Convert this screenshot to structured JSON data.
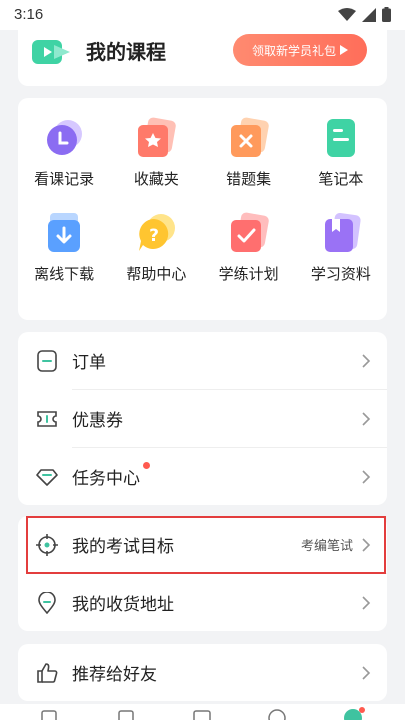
{
  "statusbar": {
    "time": "3:16"
  },
  "course": {
    "title": "我的课程",
    "promo": "领取新学员礼包"
  },
  "grid": {
    "items": [
      {
        "label": "看课记录",
        "icon": "history-icon",
        "color": "#8b6cf2"
      },
      {
        "label": "收藏夹",
        "icon": "star-folder-icon",
        "color": "#ff7a6a"
      },
      {
        "label": "错题集",
        "icon": "wrong-answers-icon",
        "color": "#ff9a5c"
      },
      {
        "label": "笔记本",
        "icon": "notebook-icon",
        "color": "#3fd3a4"
      },
      {
        "label": "离线下载",
        "icon": "download-icon",
        "color": "#5aa0ff"
      },
      {
        "label": "帮助中心",
        "icon": "help-icon",
        "color": "#ffc530"
      },
      {
        "label": "学练计划",
        "icon": "plan-check-icon",
        "color": "#ff6f6f"
      },
      {
        "label": "学习资料",
        "icon": "bookmark-icon",
        "color": "#9a72f5"
      }
    ]
  },
  "list1": [
    {
      "label": "订单",
      "icon": "order-icon"
    },
    {
      "label": "优惠券",
      "icon": "coupon-icon"
    },
    {
      "label": "任务中心",
      "icon": "task-diamond-icon",
      "dot": true
    }
  ],
  "list2": [
    {
      "label": "我的考试目标",
      "value": "考编笔试",
      "icon": "target-icon"
    },
    {
      "label": "我的收货地址",
      "icon": "location-pin-icon"
    }
  ],
  "list3": [
    {
      "label": "推荐给好友",
      "icon": "thumbs-up-icon"
    }
  ],
  "colors": {
    "accent": "#3fc3a0",
    "alert": "#ff5a4f",
    "highlight": "#e33d3d"
  }
}
